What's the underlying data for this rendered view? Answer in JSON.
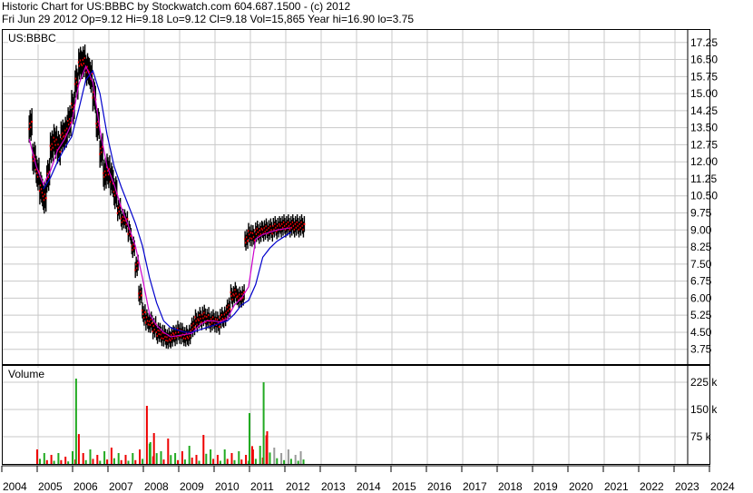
{
  "header": {
    "line1": "Historic Chart for US:BBBC by Stockwatch.com 604.687.1500 - (c) 2012",
    "line2": "Fri Jun 29 2012  Op=9.12  Hi=9.18  Lo=9.12  Cl=9.18  Vol=15,865  Year hi=16.90  lo=3.75"
  },
  "price_label": "US:BBBC",
  "volume_label": "Volume",
  "colors": {
    "price_bar": "#000000",
    "ma_short": "#cc00cc",
    "ma_long": "#0000cc",
    "dots": "#ff0000",
    "vol_up": "#22aa22",
    "vol_down": "#ee0000",
    "vol_flat": "#999999",
    "grid": "#c8c8c8"
  },
  "chart_data": [
    {
      "type": "line",
      "title": "",
      "xlabel": "",
      "ylabel": "",
      "x_ticks": [
        "2004",
        "2005",
        "2006",
        "2007",
        "2008",
        "2009",
        "2010",
        "2011",
        "2012",
        "2013",
        "2014",
        "2015",
        "2016",
        "2017",
        "2018",
        "2019",
        "2020",
        "2021",
        "2022",
        "2023",
        "2024"
      ],
      "y_ticks": [
        "17.25",
        "16.50",
        "15.75",
        "15.00",
        "14.25",
        "13.50",
        "12.75",
        "12.00",
        "11.25",
        "10.50",
        "9.75",
        "9.00",
        "8.25",
        "7.50",
        "6.75",
        "6.00",
        "5.25",
        "4.50",
        "3.75"
      ],
      "xlim": [
        2004.0,
        2024.0
      ],
      "ylim": [
        3.1,
        17.8
      ],
      "grid": true,
      "series": [
        {
          "style": "close",
          "x": [
            2004.8,
            2004.9,
            2005.0,
            2005.1,
            2005.2,
            2005.3,
            2005.4,
            2005.5,
            2005.6,
            2005.7,
            2005.8,
            2005.9,
            2006.0,
            2006.1,
            2006.2,
            2006.3,
            2006.4,
            2006.5,
            2006.6,
            2006.7,
            2006.8,
            2006.9,
            2007.0,
            2007.1,
            2007.2,
            2007.3,
            2007.4,
            2007.5,
            2007.6,
            2007.7,
            2007.8,
            2007.9,
            2008.0,
            2008.1,
            2008.2,
            2008.3,
            2008.4,
            2008.5,
            2008.6,
            2008.7,
            2008.8,
            2008.9,
            2009.0,
            2009.1,
            2009.2,
            2009.3,
            2009.4,
            2009.5,
            2009.6,
            2009.7,
            2009.8,
            2009.9,
            2010.0,
            2010.1,
            2010.2,
            2010.3,
            2010.4,
            2010.5,
            2010.6,
            2010.7,
            2010.8,
            2010.9,
            2011.0,
            2011.1,
            2011.2,
            2011.3,
            2011.4,
            2011.5,
            2011.6,
            2011.7,
            2011.8,
            2011.9,
            2012.0,
            2012.1,
            2012.2,
            2012.3,
            2012.4,
            2012.5
          ],
          "y": [
            13.6,
            12.2,
            11.5,
            10.8,
            10.4,
            11.4,
            12.7,
            12.9,
            12.6,
            13.1,
            13.3,
            13.8,
            14.4,
            15.5,
            16.3,
            16.4,
            16.1,
            15.8,
            14.9,
            13.6,
            12.5,
            11.5,
            11.6,
            11.2,
            10.6,
            9.9,
            9.5,
            9.4,
            8.9,
            8.2,
            7.4,
            6.2,
            5.3,
            5.0,
            4.9,
            4.7,
            4.5,
            4.4,
            4.3,
            4.2,
            4.3,
            4.4,
            4.5,
            4.4,
            4.3,
            4.4,
            4.8,
            5.0,
            5.1,
            5.2,
            5.1,
            5.0,
            5.0,
            4.9,
            5.1,
            5.2,
            5.6,
            6.1,
            6.2,
            6.0,
            6.1,
            8.6,
            8.8,
            8.7,
            8.9,
            8.9,
            9.0,
            9.0,
            9.0,
            9.1,
            9.1,
            9.18,
            9.18,
            9.18,
            9.18,
            9.18,
            9.18,
            9.18
          ]
        },
        {
          "name": "",
          "style": "ma_short",
          "x": [
            2004.8,
            2005.0,
            2005.2,
            2005.4,
            2005.6,
            2005.8,
            2006.0,
            2006.2,
            2006.4,
            2006.6,
            2006.8,
            2007.0,
            2007.2,
            2007.4,
            2007.6,
            2007.8,
            2008.0,
            2008.2,
            2008.4,
            2008.6,
            2008.8,
            2009.0,
            2009.2,
            2009.4,
            2009.6,
            2009.8,
            2010.0,
            2010.2,
            2010.4,
            2010.6,
            2010.8,
            2011.0,
            2011.2,
            2011.4,
            2011.6,
            2011.8,
            2012.0,
            2012.2
          ],
          "y": [
            13.0,
            11.8,
            11.0,
            11.6,
            12.5,
            13.0,
            13.7,
            15.4,
            16.2,
            15.5,
            13.4,
            11.8,
            11.0,
            10.0,
            9.2,
            8.3,
            6.9,
            5.3,
            4.8,
            4.5,
            4.3,
            4.35,
            4.4,
            4.45,
            4.8,
            5.0,
            5.0,
            4.95,
            5.1,
            5.7,
            6.0,
            6.5,
            8.6,
            8.8,
            8.9,
            9.0,
            9.05,
            9.1
          ]
        },
        {
          "name": "",
          "style": "ma_long",
          "x": [
            2005.2,
            2005.4,
            2005.6,
            2005.8,
            2006.0,
            2006.2,
            2006.4,
            2006.6,
            2006.8,
            2007.0,
            2007.2,
            2007.4,
            2007.6,
            2007.8,
            2008.0,
            2008.2,
            2008.4,
            2008.6,
            2008.8,
            2009.0,
            2009.2,
            2009.4,
            2009.6,
            2009.8,
            2010.0,
            2010.2,
            2010.4,
            2010.6,
            2010.8,
            2011.0,
            2011.2,
            2011.4,
            2011.6,
            2011.8,
            2012.0,
            2012.2
          ],
          "y": [
            10.8,
            11.3,
            12.0,
            12.6,
            13.1,
            14.3,
            15.6,
            16.0,
            15.0,
            13.2,
            11.8,
            10.9,
            10.1,
            9.3,
            8.3,
            6.9,
            5.8,
            5.0,
            4.7,
            4.6,
            4.5,
            4.5,
            4.6,
            4.7,
            4.8,
            4.9,
            5.0,
            5.3,
            5.7,
            5.9,
            6.6,
            7.8,
            8.2,
            8.5,
            8.7,
            8.9
          ]
        }
      ]
    },
    {
      "type": "bar",
      "title": "",
      "y_ticks": [
        "225 k",
        "150 k",
        "75 k"
      ],
      "ylim": [
        0,
        270
      ],
      "unit": "k",
      "x": [
        2005.0,
        2005.2,
        2005.4,
        2005.6,
        2005.8,
        2006.0,
        2006.1,
        2006.3,
        2006.5,
        2006.7,
        2006.9,
        2007.1,
        2007.3,
        2007.5,
        2007.7,
        2007.9,
        2008.1,
        2008.2,
        2008.3,
        2008.5,
        2008.7,
        2008.9,
        2009.1,
        2009.3,
        2009.5,
        2009.7,
        2009.9,
        2010.1,
        2010.3,
        2010.5,
        2010.7,
        2010.9,
        2011.0,
        2011.1,
        2011.3,
        2011.4,
        2011.5,
        2011.7,
        2011.9,
        2012.1,
        2012.3,
        2012.45
      ],
      "values": [
        40,
        30,
        25,
        30,
        20,
        35,
        235,
        30,
        40,
        25,
        35,
        45,
        30,
        25,
        30,
        40,
        160,
        60,
        85,
        35,
        70,
        30,
        35,
        50,
        25,
        80,
        40,
        25,
        40,
        30,
        35,
        25,
        140,
        40,
        50,
        225,
        90,
        45,
        30,
        40,
        25,
        35
      ],
      "dir": [
        "down",
        "up",
        "down",
        "up",
        "down",
        "up",
        "up",
        "down",
        "up",
        "down",
        "up",
        "down",
        "up",
        "down",
        "up",
        "down",
        "down",
        "up",
        "down",
        "up",
        "down",
        "up",
        "down",
        "up",
        "down",
        "down",
        "up",
        "down",
        "up",
        "down",
        "up",
        "down",
        "up",
        "down",
        "up",
        "up",
        "down",
        "flat",
        "flat",
        "flat",
        "flat",
        "flat"
      ]
    }
  ]
}
